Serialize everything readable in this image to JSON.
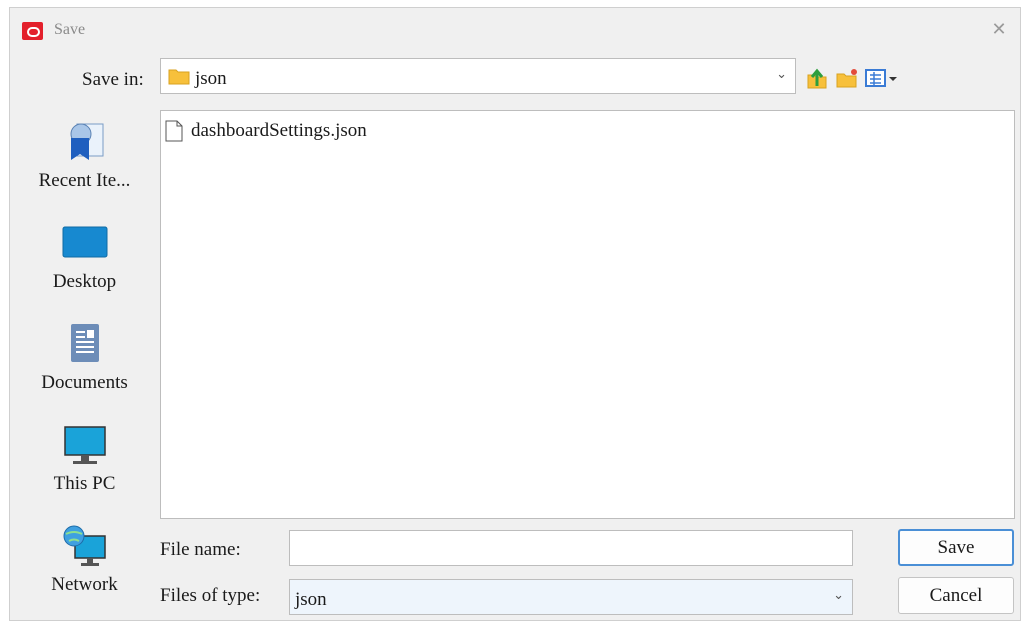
{
  "window": {
    "title": "Save",
    "close_glyph": "✕"
  },
  "save_in": {
    "label": "Save in:",
    "value": "json",
    "icon": "folder-icon"
  },
  "toolbar": {
    "icons": [
      "up-folder-icon",
      "new-folder-icon",
      "view-menu-icon"
    ]
  },
  "places": [
    {
      "label": "Recent Ite...",
      "icon": "recent-items-icon"
    },
    {
      "label": "Desktop",
      "icon": "desktop-icon"
    },
    {
      "label": "Documents",
      "icon": "documents-icon"
    },
    {
      "label": "This PC",
      "icon": "this-pc-icon"
    },
    {
      "label": "Network",
      "icon": "network-icon"
    }
  ],
  "files": [
    {
      "name": "dashboardSettings.json",
      "icon": "file-icon"
    }
  ],
  "file_name": {
    "label": "File name:",
    "value": ""
  },
  "file_type": {
    "label": "Files of type:",
    "value": "json"
  },
  "buttons": {
    "save": "Save",
    "cancel": "Cancel"
  },
  "colors": {
    "accent": "#4a8fd6",
    "brand": "#e3202b",
    "folder": "#f7c03b"
  }
}
